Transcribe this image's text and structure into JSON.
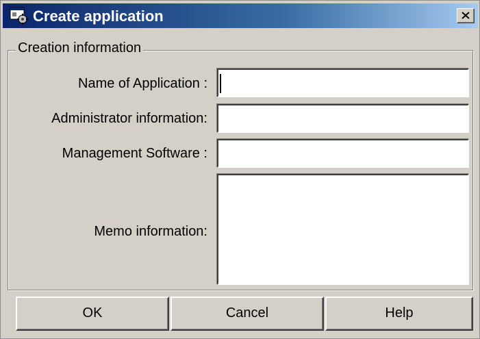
{
  "window": {
    "title": "Create application",
    "close_icon": "close-icon",
    "app_icon": "application-config-icon"
  },
  "group": {
    "legend": "Creation information",
    "fields": {
      "name": {
        "label": "Name of Application :",
        "value": ""
      },
      "admin": {
        "label": "Administrator information:",
        "value": ""
      },
      "software": {
        "label": "Management Software :",
        "value": ""
      },
      "memo": {
        "label": "Memo information:",
        "value": ""
      }
    }
  },
  "buttons": {
    "ok": "OK",
    "cancel": "Cancel",
    "help": "Help"
  },
  "colors": {
    "title_start": "#0a246a",
    "title_end": "#a6caf0",
    "face": "#d4d0c8"
  }
}
